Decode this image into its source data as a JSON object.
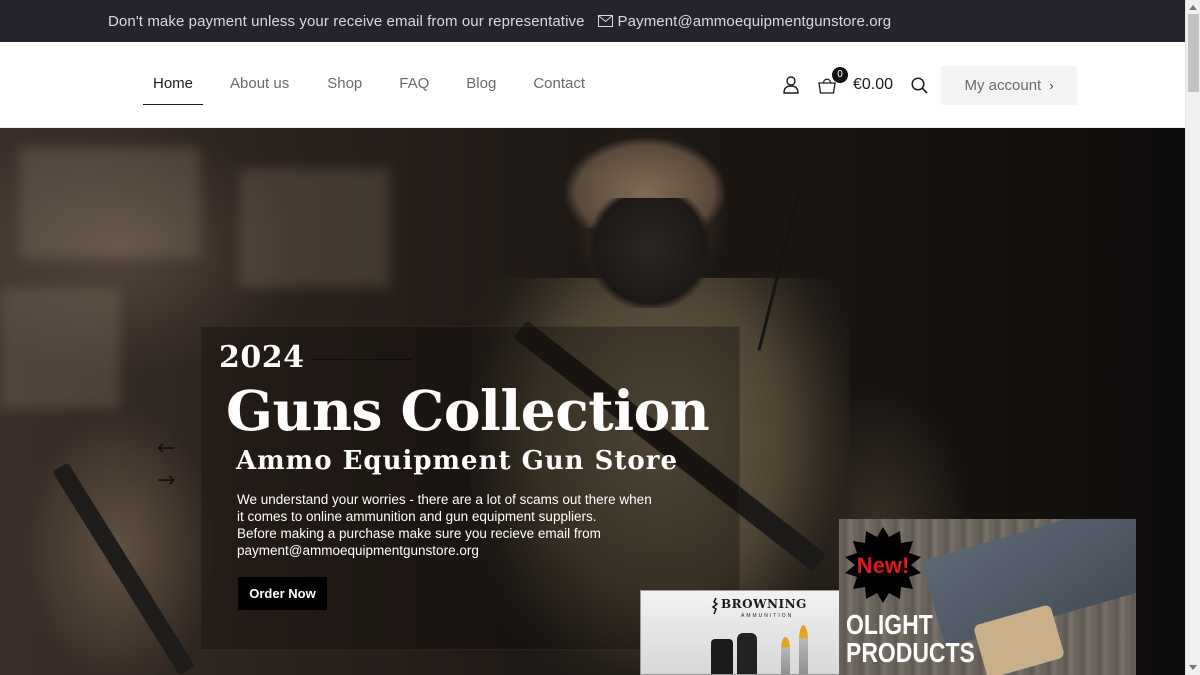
{
  "topbar": {
    "notice": "Don't make payment unless your receive email from our representative",
    "email_icon": "envelope-icon",
    "email": "Payment@ammoequipmentgunstore.org"
  },
  "nav": {
    "items": [
      {
        "label": "Home",
        "active": true
      },
      {
        "label": "About us",
        "active": false
      },
      {
        "label": "Shop",
        "active": false
      },
      {
        "label": "FAQ",
        "active": false
      },
      {
        "label": "Blog",
        "active": false
      },
      {
        "label": "Contact",
        "active": false
      }
    ]
  },
  "header_actions": {
    "user_icon": "user-icon",
    "cart_icon": "shopping-bag-icon",
    "cart_count": "0",
    "cart_total": "€0.00",
    "search_icon": "search-icon",
    "account_label": "My account",
    "account_chevron": "›"
  },
  "hero": {
    "year": "2024",
    "title": "Guns Collection",
    "subtitle": "Ammo Equipment Gun Store",
    "description_lines": [
      "We understand your worries - there are a lot of scams out there when it comes to online ammunition and gun equipment suppliers.",
      "Before making a purchase make sure you recieve email from payment@ammoequipmentgunstore.org"
    ],
    "cta_label": "Order Now",
    "prev_arrow": "←",
    "next_arrow": "→"
  },
  "promos": {
    "browning": {
      "brand": "BROWNING",
      "sub": "AMMUNITION"
    },
    "olight": {
      "badge": "New!",
      "line1": "OLIGHT",
      "line2": "PRODUCTS"
    }
  },
  "colors": {
    "topbar_bg": "#24242c",
    "accent_dark": "#000000",
    "badge_red": "#e3161b"
  }
}
